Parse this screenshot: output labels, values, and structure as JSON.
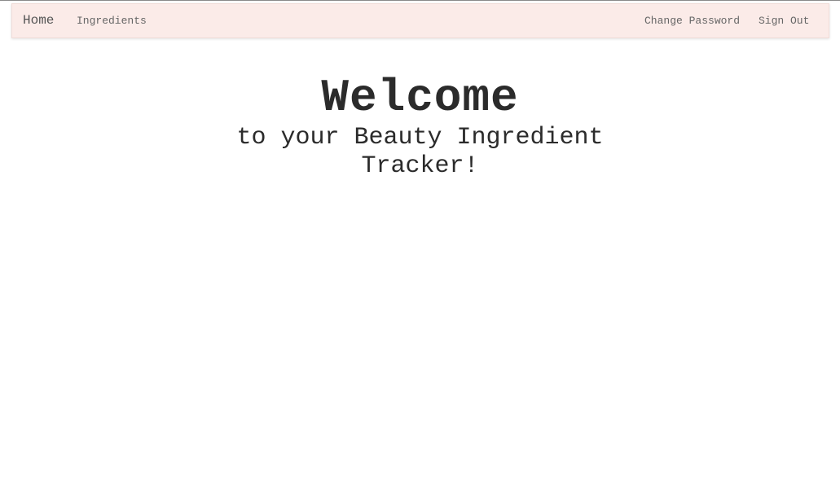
{
  "navbar": {
    "brand": "Home",
    "left_links": [
      "Ingredients"
    ],
    "right_links": [
      "Change Password",
      "Sign Out"
    ]
  },
  "hero": {
    "title": "Welcome",
    "subtitle": "to your Beauty Ingredient Tracker!"
  }
}
